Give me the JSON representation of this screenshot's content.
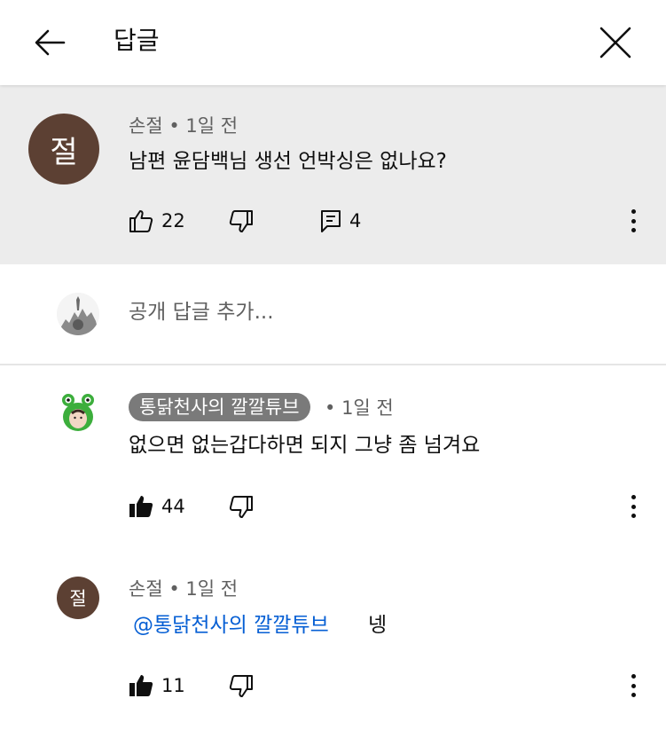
{
  "header": {
    "title": "답글"
  },
  "parent": {
    "avatar_letter": "절",
    "author": "손절",
    "time": "1일 전",
    "text": "남편 윤담백님 생선 언박싱은 없나요?",
    "likes": "22",
    "replies": "4"
  },
  "add_reply": {
    "placeholder": "공개 답글 추가..."
  },
  "replies": [
    {
      "author": "통닭천사의 깔깔튜브",
      "time": "1일 전",
      "text": "없으면 없는갑다하면 되지 그냥 좀 넘겨요",
      "likes": "44"
    },
    {
      "avatar_letter": "절",
      "author": "손절",
      "time": "1일 전",
      "mention": "@통닭천사의 깔깔튜브",
      "text": "넹",
      "likes": "11"
    }
  ],
  "colors": {
    "avatar_bg": "#5c4033",
    "mention": "#065fd4",
    "highlight_bg": "#ececec",
    "badge_bg": "#7a7a7a"
  },
  "icons": [
    "back-arrow-icon",
    "close-icon",
    "thumbs-up-icon",
    "thumbs-down-icon",
    "reply-icon",
    "more-vert-icon"
  ]
}
